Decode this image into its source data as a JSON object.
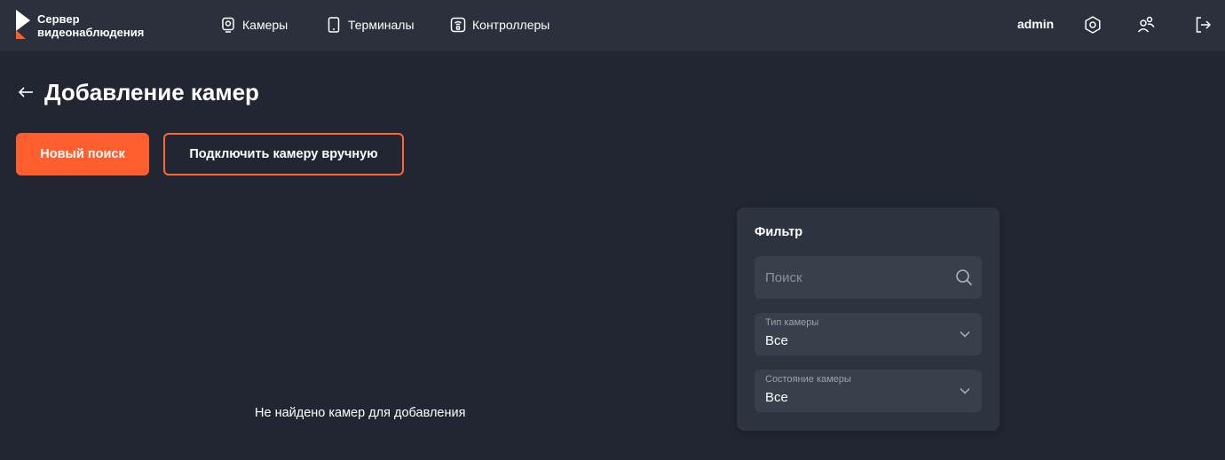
{
  "app": {
    "logo_line1": "Сервер",
    "logo_line2": "видеонаблюдения",
    "accent_color": "#ff5f2e"
  },
  "nav": {
    "items": [
      {
        "label": "Камеры",
        "icon": "camera-icon"
      },
      {
        "label": "Терминалы",
        "icon": "terminal-icon"
      },
      {
        "label": "Контроллеры",
        "icon": "controller-icon"
      }
    ]
  },
  "user": {
    "name": "admin",
    "icons": [
      "settings-icon",
      "users-icon",
      "logout-icon"
    ]
  },
  "page": {
    "title": "Добавление камер",
    "back_icon": "arrow-left-icon"
  },
  "actions": {
    "new_search": "Новый поиск",
    "connect_manually": "Подключить камеру вручную"
  },
  "results": {
    "empty_message": "Не найдено камер для добавления"
  },
  "filter": {
    "title": "Фильтр",
    "search_placeholder": "Поиск",
    "search_value": "",
    "camera_type_label": "Тип камеры",
    "camera_type_value": "Все",
    "camera_state_label": "Состояние камеры",
    "camera_state_value": "Все"
  }
}
